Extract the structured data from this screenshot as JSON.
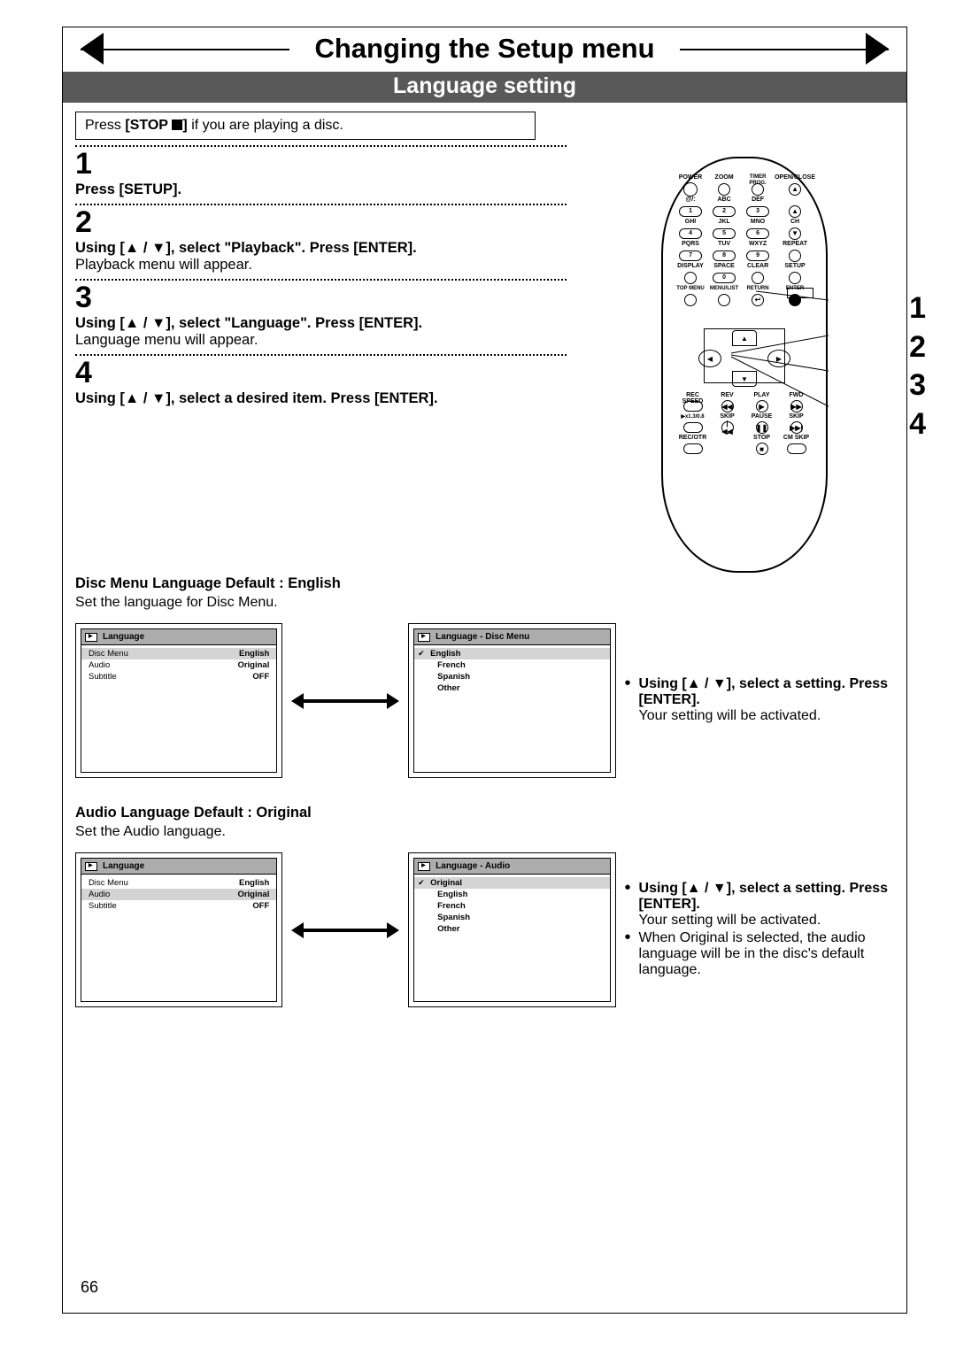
{
  "header": {
    "main_title": "Changing the Setup menu",
    "subtitle": "Language setting"
  },
  "notice": {
    "pre": "Press",
    "btn": "[STOP",
    "post": "] if you are playing a disc."
  },
  "steps": [
    {
      "num": "1",
      "bold": "Press [SETUP].",
      "body": ""
    },
    {
      "num": "2",
      "bold": "Using [▲ / ▼], select \"Playback\". Press [ENTER].",
      "body": "Playback menu will appear."
    },
    {
      "num": "3",
      "bold": "Using [▲ / ▼], select \"Language\". Press [ENTER].",
      "body": "Language menu will appear."
    },
    {
      "num": "4",
      "bold": "Using [▲ / ▼], select a desired item. Press [ENTER].",
      "body": ""
    }
  ],
  "remote": {
    "row1_labels": [
      "POWER",
      "ZOOM",
      "TIMER PROG.",
      "OPEN/CLOSE"
    ],
    "row2_labels": [
      "@/:",
      "ABC",
      "DEF",
      ""
    ],
    "row2_btns": [
      "1",
      "2",
      "3",
      ""
    ],
    "row3_labels": [
      "GHI",
      "JKL",
      "MNO",
      "CH"
    ],
    "row3_btns": [
      "4",
      "5",
      "6",
      ""
    ],
    "row4_labels": [
      "PQRS",
      "TUV",
      "WXYZ",
      "REPEAT"
    ],
    "row4_btns": [
      "7",
      "8",
      "9",
      ""
    ],
    "row5_labels": [
      "DISPLAY",
      "SPACE",
      "CLEAR",
      "SETUP"
    ],
    "row5_btns": [
      "",
      "0",
      "",
      ""
    ],
    "row6_labels": [
      "TOP MENU",
      "MENU/LIST",
      "RETURN",
      "ENTER"
    ],
    "bottom_labels": [
      "REC SPEED",
      "REV",
      "PLAY",
      "FWD",
      "▶x1.3/0.8",
      "SKIP",
      "PAUSE",
      "SKIP",
      "REC/OTR",
      "",
      "STOP",
      "CM SKIP"
    ],
    "dpad": {
      "up": "▲",
      "down": "▼",
      "left": "◀",
      "right": "▶"
    },
    "callouts": [
      "1",
      "2",
      "3",
      "4"
    ]
  },
  "section_disc_menu": {
    "heading_bold": "Disc Menu Language Default : English",
    "sub": "Set the language for Disc Menu.",
    "left_menu": {
      "title": "Language",
      "rows": [
        [
          "Disc Menu",
          "English"
        ],
        [
          "Audio",
          "Original"
        ],
        [
          "Subtitle",
          "OFF"
        ]
      ],
      "highlight": 0
    },
    "right_menu": {
      "title": "Language - Disc Menu",
      "options": [
        "English",
        "French",
        "Spanish",
        "Other"
      ],
      "highlight": 0
    },
    "desc": {
      "b1_bold": "Using [▲ / ▼], select a setting. Press [ENTER].",
      "b1_body": "Your setting will be activated."
    }
  },
  "section_audio": {
    "heading_bold": "Audio Language Default : Original",
    "sub": "Set the Audio language.",
    "left_menu": {
      "title": "Language",
      "rows": [
        [
          "Disc Menu",
          "English"
        ],
        [
          "Audio",
          "Original"
        ],
        [
          "Subtitle",
          "OFF"
        ]
      ],
      "highlight": 1
    },
    "right_menu": {
      "title": "Language - Audio",
      "options": [
        "Original",
        "English",
        "French",
        "Spanish",
        "Other"
      ],
      "highlight": 0
    },
    "desc": {
      "b1_bold": "Using [▲ / ▼], select a setting. Press [ENTER].",
      "b1_body": "Your setting will be activated.",
      "b2": "When Original is selected, the audio language will be in the disc's default language."
    }
  },
  "page_number": "66"
}
